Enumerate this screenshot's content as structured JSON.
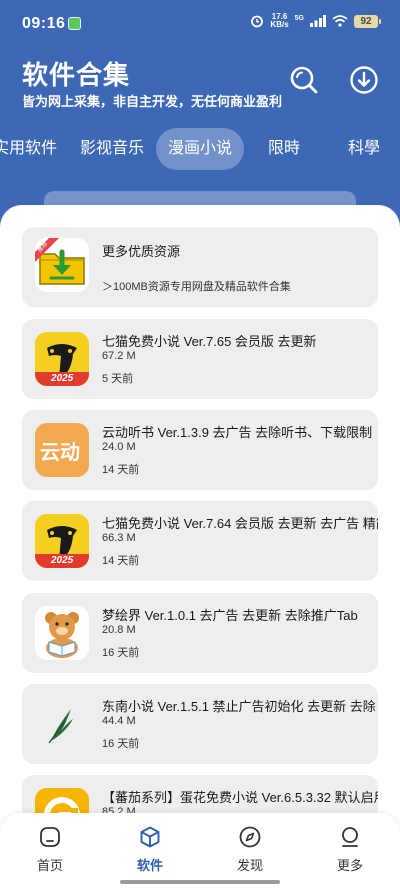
{
  "status_bar": {
    "time": "09:16",
    "net_speed_value": "17.6",
    "net_speed_unit": "KB/s",
    "network": "5G",
    "battery": "92"
  },
  "header": {
    "title": "软件合集",
    "subtitle": "皆为网上采集，非自主开发，无任何商业盈利",
    "search_icon": "search-icon",
    "download_icon": "download-icon"
  },
  "tabs": [
    {
      "label": "实用软件"
    },
    {
      "label": "影视音乐"
    },
    {
      "label": "漫画小说",
      "active": true
    },
    {
      "label": "限時"
    },
    {
      "label": "科學"
    }
  ],
  "promo": {
    "title": "更多优质资源",
    "subtitle": "＞100MB资源专用网盘及精品软件合集",
    "badge": "推荐"
  },
  "items": [
    {
      "title": "七猫免费小说 Ver.7.65 会员版 去更新",
      "size": "67.2 M",
      "time": "5 天前",
      "icon_text": "2025"
    },
    {
      "title": "云动听书 Ver.1.3.9 去广告 去除听书、下载限制",
      "size": "24.0 M",
      "time": "14 天前",
      "icon_text": "云动"
    },
    {
      "title": "七猫免费小说 Ver.7.64 会员版 去更新 去广告 精简",
      "size": "66.3 M",
      "time": "14 天前",
      "icon_text": "2025"
    },
    {
      "title": "梦绘界 Ver.1.0.1 去广告 去更新 去除推广Tab",
      "size": "20.8 M",
      "time": "16 天前"
    },
    {
      "title": "东南小说 Ver.1.5.1 禁止广告初始化 去更新 去除",
      "size": "44.4 M",
      "time": "16 天前"
    },
    {
      "title": "【蕃茄系列】蛋花免费小说 Ver.6.5.3.32 默认启用",
      "size": "85.2 M",
      "time": ""
    }
  ],
  "bottom_nav": [
    {
      "label": "首页"
    },
    {
      "label": "软件",
      "active": true
    },
    {
      "label": "发现"
    },
    {
      "label": "更多"
    }
  ],
  "colors": {
    "header_bg": "#3c68b5",
    "card_bg": "#eeeeee",
    "accent": "#2d5fb0"
  }
}
